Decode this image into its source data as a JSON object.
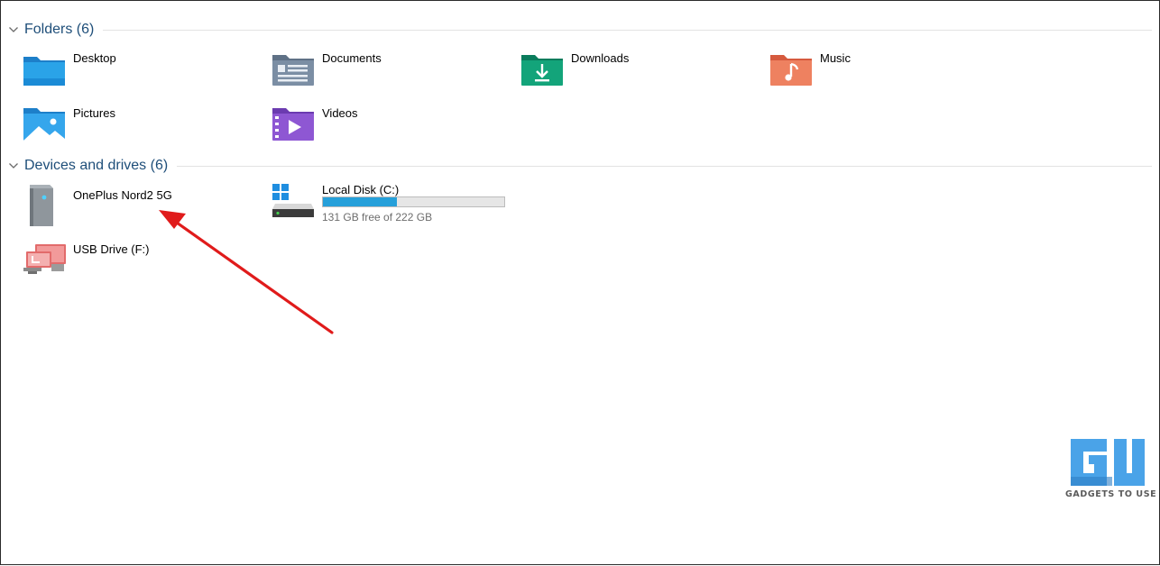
{
  "sections": {
    "folders": {
      "title": "Folders (6)"
    },
    "devices": {
      "title": "Devices and drives (6)"
    }
  },
  "folders": [
    {
      "label": "Desktop",
      "icon": "desktop-folder-icon"
    },
    {
      "label": "Documents",
      "icon": "documents-folder-icon"
    },
    {
      "label": "Downloads",
      "icon": "downloads-folder-icon"
    },
    {
      "label": "Music",
      "icon": "music-folder-icon"
    },
    {
      "label": "Pictures",
      "icon": "pictures-folder-icon"
    },
    {
      "label": "Videos",
      "icon": "videos-folder-icon"
    }
  ],
  "devices": [
    {
      "label": "OnePlus Nord2 5G",
      "icon": "phone-device-icon"
    },
    {
      "label": "Local Disk (C:)",
      "icon": "windows-drive-icon",
      "free_text": "131 GB free of 222 GB",
      "used_fraction": 0.41
    },
    {
      "label": "USB Drive (F:)",
      "icon": "usb-drive-icon"
    }
  ],
  "watermark": {
    "text": "GADGETS TO USE"
  },
  "colors": {
    "header_text": "#1e4e79",
    "bar_fill": "#26a0da",
    "arrow": "#e01b1b"
  }
}
